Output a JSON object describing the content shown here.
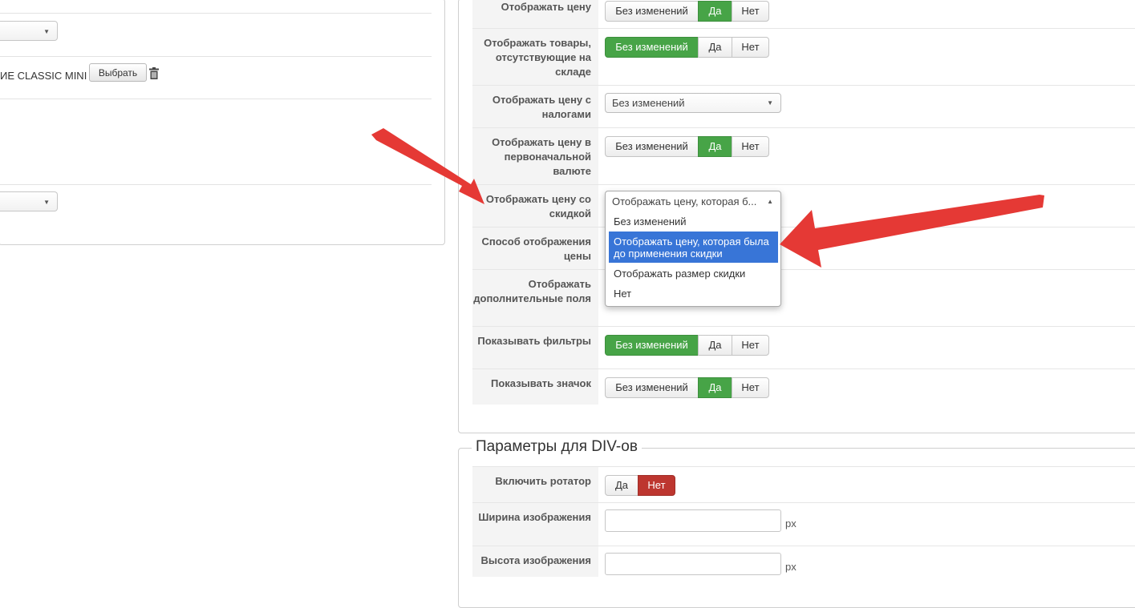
{
  "left_panel": {
    "product_text": "ИЕ CLASSIC MINI",
    "choose_button": "Выбрать"
  },
  "options": {
    "rows": [
      {
        "label": "Отображать цену",
        "control": "buttons",
        "active": 1
      },
      {
        "label": "Отображать товары, отсутствующие на складе",
        "control": "buttons",
        "active": 0
      },
      {
        "label": "Отображать цену с налогами",
        "control": "select",
        "value": "Без изменений"
      },
      {
        "label": "Отображать цену в первоначальной валюте",
        "control": "buttons",
        "active": 1
      },
      {
        "label": "Отображать цену со скидкой",
        "control": "select-open",
        "value": "Отображать цену, которая б..."
      },
      {
        "label": "Способ отображения цены"
      },
      {
        "label": "Отображать дополнительные поля"
      },
      {
        "label": "Показывать фильтры",
        "control": "buttons",
        "active": 0
      },
      {
        "label": "Показывать значок",
        "control": "buttons",
        "active": 1
      }
    ],
    "button_labels": [
      "Без изменений",
      "Да",
      "Нет"
    ]
  },
  "dropdown": {
    "current": "Отображать цену, которая б...",
    "options": [
      "Без изменений",
      "Отображать цену, которая была до применения скидки",
      "Отображать размер скидки",
      "Нет"
    ],
    "selected_index": 1
  },
  "div_params": {
    "legend": "Параметры для DIV-ов",
    "rotator_label": "Включить ротатор",
    "rotator_buttons": [
      "Да",
      "Нет"
    ],
    "width_label": "Ширина изображения",
    "height_label": "Высота изображения",
    "unit": "px"
  },
  "colors": {
    "green_active": "#47a447",
    "red_active": "#bd362f",
    "dropdown_selected": "#3875d7",
    "annotation_arrow": "#e53935"
  }
}
